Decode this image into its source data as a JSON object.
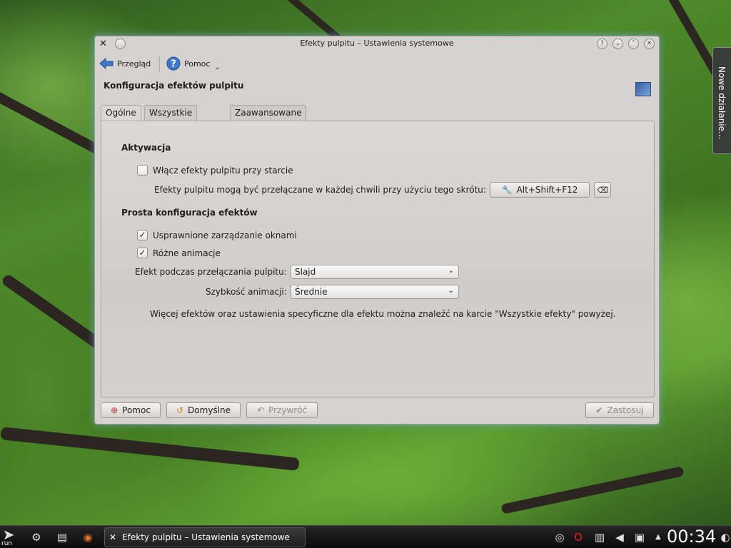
{
  "side_panel": {
    "label": "Nowe działanie..."
  },
  "window": {
    "title": "Efekty pulpitu – Ustawienia systemowe",
    "titlebar_buttons": [
      "?",
      "⌄",
      "⌃",
      "✕"
    ],
    "toolbar": {
      "back_label": "Przegląd",
      "help_label": "Pomoc"
    },
    "heading": "Konfiguracja efektów pulpitu",
    "tabs": [
      {
        "label": "Ogólne"
      },
      {
        "label": "Wszystkie efekty"
      },
      {
        "label": "Zaawansowane"
      }
    ],
    "activation": {
      "title": "Aktywacja",
      "enable_checkbox": {
        "label": "Włącz efekty pulpitu przy starcie",
        "checked": false
      },
      "shortcut_text": "Efekty pulpitu mogą być przełączane w każdej chwili przy użyciu tego skrótu:",
      "shortcut_value": "Alt+Shift+F12"
    },
    "simple": {
      "title": "Prosta konfiguracja efektów",
      "improved_window_mgmt": {
        "label": "Usprawnione zarządzanie oknami",
        "checked": true
      },
      "various_animations": {
        "label": "Różne animacje",
        "checked": true
      },
      "desktop_switch_label": "Efekt podczas przełączania pulpitu:",
      "desktop_switch_value": "Slajd",
      "animation_speed_label": "Szybkość animacji:",
      "animation_speed_value": "Średnie",
      "info_text": "Więcej efektów oraz ustawienia specyficzne dla efektu można znaleźć na karcie \"Wszystkie efekty\" powyżej."
    },
    "buttons": {
      "help": "Pomoc",
      "defaults": "Domyślne",
      "revert": "Przywróć",
      "apply": "Zastosuj"
    }
  },
  "taskbar": {
    "launcher_label": "run",
    "task_label": "Efekty pulpitu – Ustawienia systemowe",
    "clock": "00:34"
  }
}
